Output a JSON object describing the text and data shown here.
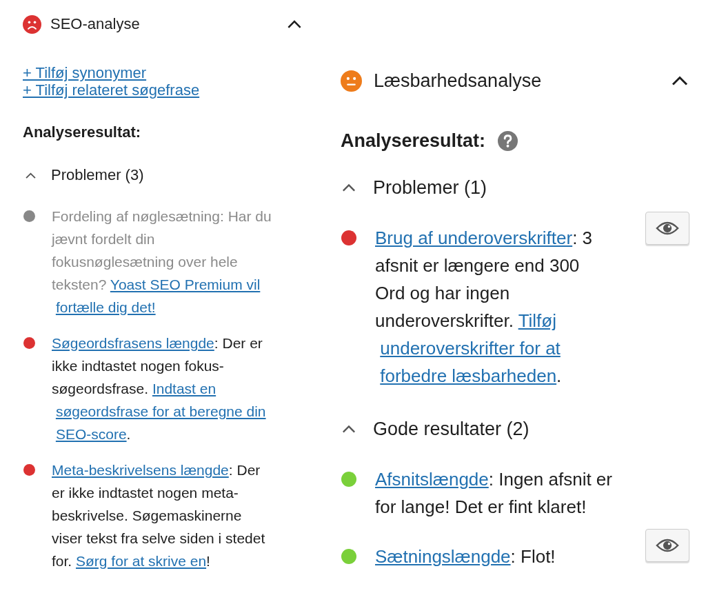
{
  "panels": [
    {
      "title": "SEO-analyse",
      "kind": "sad",
      "color": "#dc3232",
      "expanded": true,
      "links": [
        "+ Tilføj synonymer",
        "+ Tilføj relateret søgefrase"
      ],
      "results_heading": "Analyseresultat:",
      "help_icon": false,
      "groups": [
        {
          "title": "Problemer (3)",
          "expanded": true,
          "items": [
            {
              "color": "#888888",
              "muted": true,
              "eye_button": false,
              "segments": [
                {
                  "kind": "text",
                  "text": "Fordeling af nøglesætning: Har du jævnt fordelt din fokusnøglesætning over hele teksten? "
                },
                {
                  "kind": "link",
                  "text": "Yoast SEO Premium vil"
                },
                {
                  "kind": "link",
                  "text": "fortælle dig det!"
                }
              ]
            },
            {
              "color": "#dc3232",
              "muted": false,
              "eye_button": false,
              "segments": [
                {
                  "kind": "link",
                  "text": "Søgeordsfrasens længde"
                },
                {
                  "kind": "text",
                  "text": ": Der er ikke indtastet nogen fokus-søgeordsfrase. "
                },
                {
                  "kind": "link",
                  "text": "Indtast en"
                },
                {
                  "kind": "link",
                  "text": "søgeordsfrase for at beregne din"
                },
                {
                  "kind": "link",
                  "text": "SEO-score"
                },
                {
                  "kind": "text",
                  "text": "."
                }
              ]
            },
            {
              "color": "#dc3232",
              "muted": false,
              "eye_button": false,
              "segments": [
                {
                  "kind": "link",
                  "text": "Meta-beskrivelsens længde"
                },
                {
                  "kind": "text",
                  "text": ": Der er ikke indtastet nogen meta-beskrivelse. Søgemaskinerne viser tekst fra selve siden i stedet for. "
                },
                {
                  "kind": "link",
                  "text": "Sørg for at skrive en"
                },
                {
                  "kind": "text",
                  "text": "!"
                }
              ]
            }
          ]
        }
      ]
    },
    {
      "title": "Læsbarhedsanalyse",
      "kind": "neutral",
      "color": "#ee7c1b",
      "expanded": true,
      "results_heading": "Analyseresultat:",
      "help_icon": true,
      "groups": [
        {
          "title": "Problemer (1)",
          "expanded": true,
          "items": [
            {
              "color": "#dc3232",
              "muted": false,
              "eye_button": true,
              "segments": [
                {
                  "kind": "link",
                  "text": "Brug af underoverskrifter"
                },
                {
                  "kind": "text",
                  "text": ": 3 afsnit er længere end 300 Ord og har ingen underoverskrifter. "
                },
                {
                  "kind": "link",
                  "text": "Tilføj"
                },
                {
                  "kind": "link",
                  "text": "underoverskrifter for at"
                },
                {
                  "kind": "link",
                  "text": "forbedre læsbarheden"
                },
                {
                  "kind": "text",
                  "text": "."
                }
              ]
            }
          ]
        },
        {
          "title": "Gode resultater (2)",
          "expanded": true,
          "items": [
            {
              "color": "#7ad03a",
              "muted": false,
              "eye_button": false,
              "segments": [
                {
                  "kind": "link",
                  "text": "Afsnitslængde"
                },
                {
                  "kind": "text",
                  "text": ": Ingen afsnit er for lange! Det er fint klaret!"
                }
              ]
            },
            {
              "color": "#7ad03a",
              "muted": false,
              "eye_button": true,
              "segments": [
                {
                  "kind": "link",
                  "text": "Sætningslængde"
                },
                {
                  "kind": "text",
                  "text": ": Flot!"
                }
              ]
            }
          ]
        }
      ]
    }
  ]
}
